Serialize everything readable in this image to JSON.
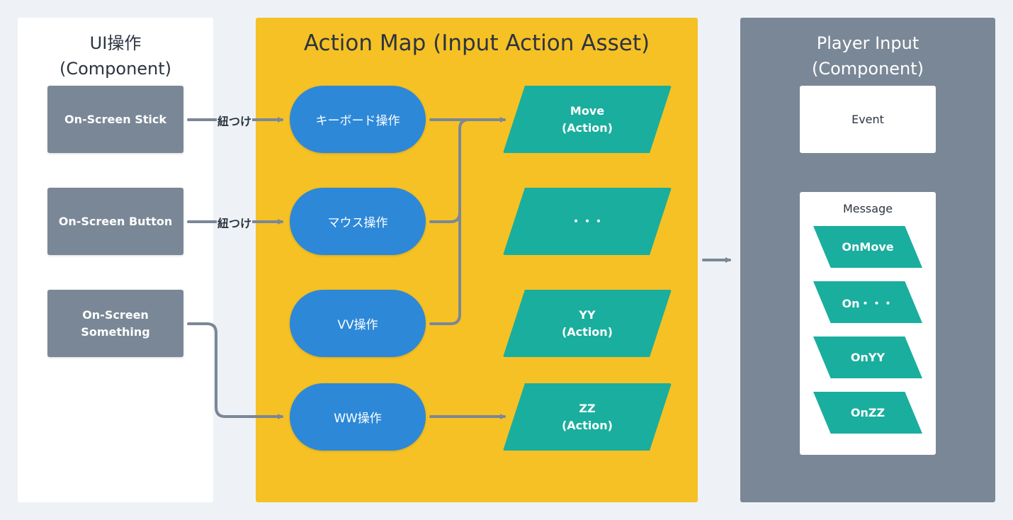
{
  "colors": {
    "background": "#eef2f6",
    "ui_panel": "#ffffff",
    "action_map_panel": "#f6c124",
    "player_input_panel": "#7a8796",
    "ui_box": "#7a8796",
    "control_pill": "#2d88d8",
    "action_shape": "#1aae9e",
    "connector": "#7a8796"
  },
  "ui_panel": {
    "title_line1": "UI操作",
    "title_line2": "(Component)",
    "items": [
      {
        "label": "On-Screen Stick"
      },
      {
        "label": "On-Screen Button"
      },
      {
        "label_line1": "On-Screen",
        "label_line2": "Something"
      }
    ]
  },
  "connector_labels": {
    "stick_link": "紐つけ",
    "button_link": "紐つけ"
  },
  "action_map": {
    "title": "Action Map (Input Action Asset)",
    "controls": [
      {
        "label": "キーボード操作"
      },
      {
        "label": "マウス操作"
      },
      {
        "label": "VV操作"
      },
      {
        "label": "WW操作"
      }
    ],
    "actions": [
      {
        "line1": "Move",
        "line2": "(Action)"
      },
      {
        "line1": "・・・",
        "line2": ""
      },
      {
        "line1": "YY",
        "line2": "(Action)"
      },
      {
        "line1": "ZZ",
        "line2": "(Action)"
      }
    ]
  },
  "player_input": {
    "title_line1": "Player Input",
    "title_line2": "(Component)",
    "event_label": "Event",
    "message_label": "Message",
    "messages": [
      {
        "label": "OnMove"
      },
      {
        "label": "On・・・"
      },
      {
        "label": "OnYY"
      },
      {
        "label": "OnZZ"
      }
    ]
  }
}
